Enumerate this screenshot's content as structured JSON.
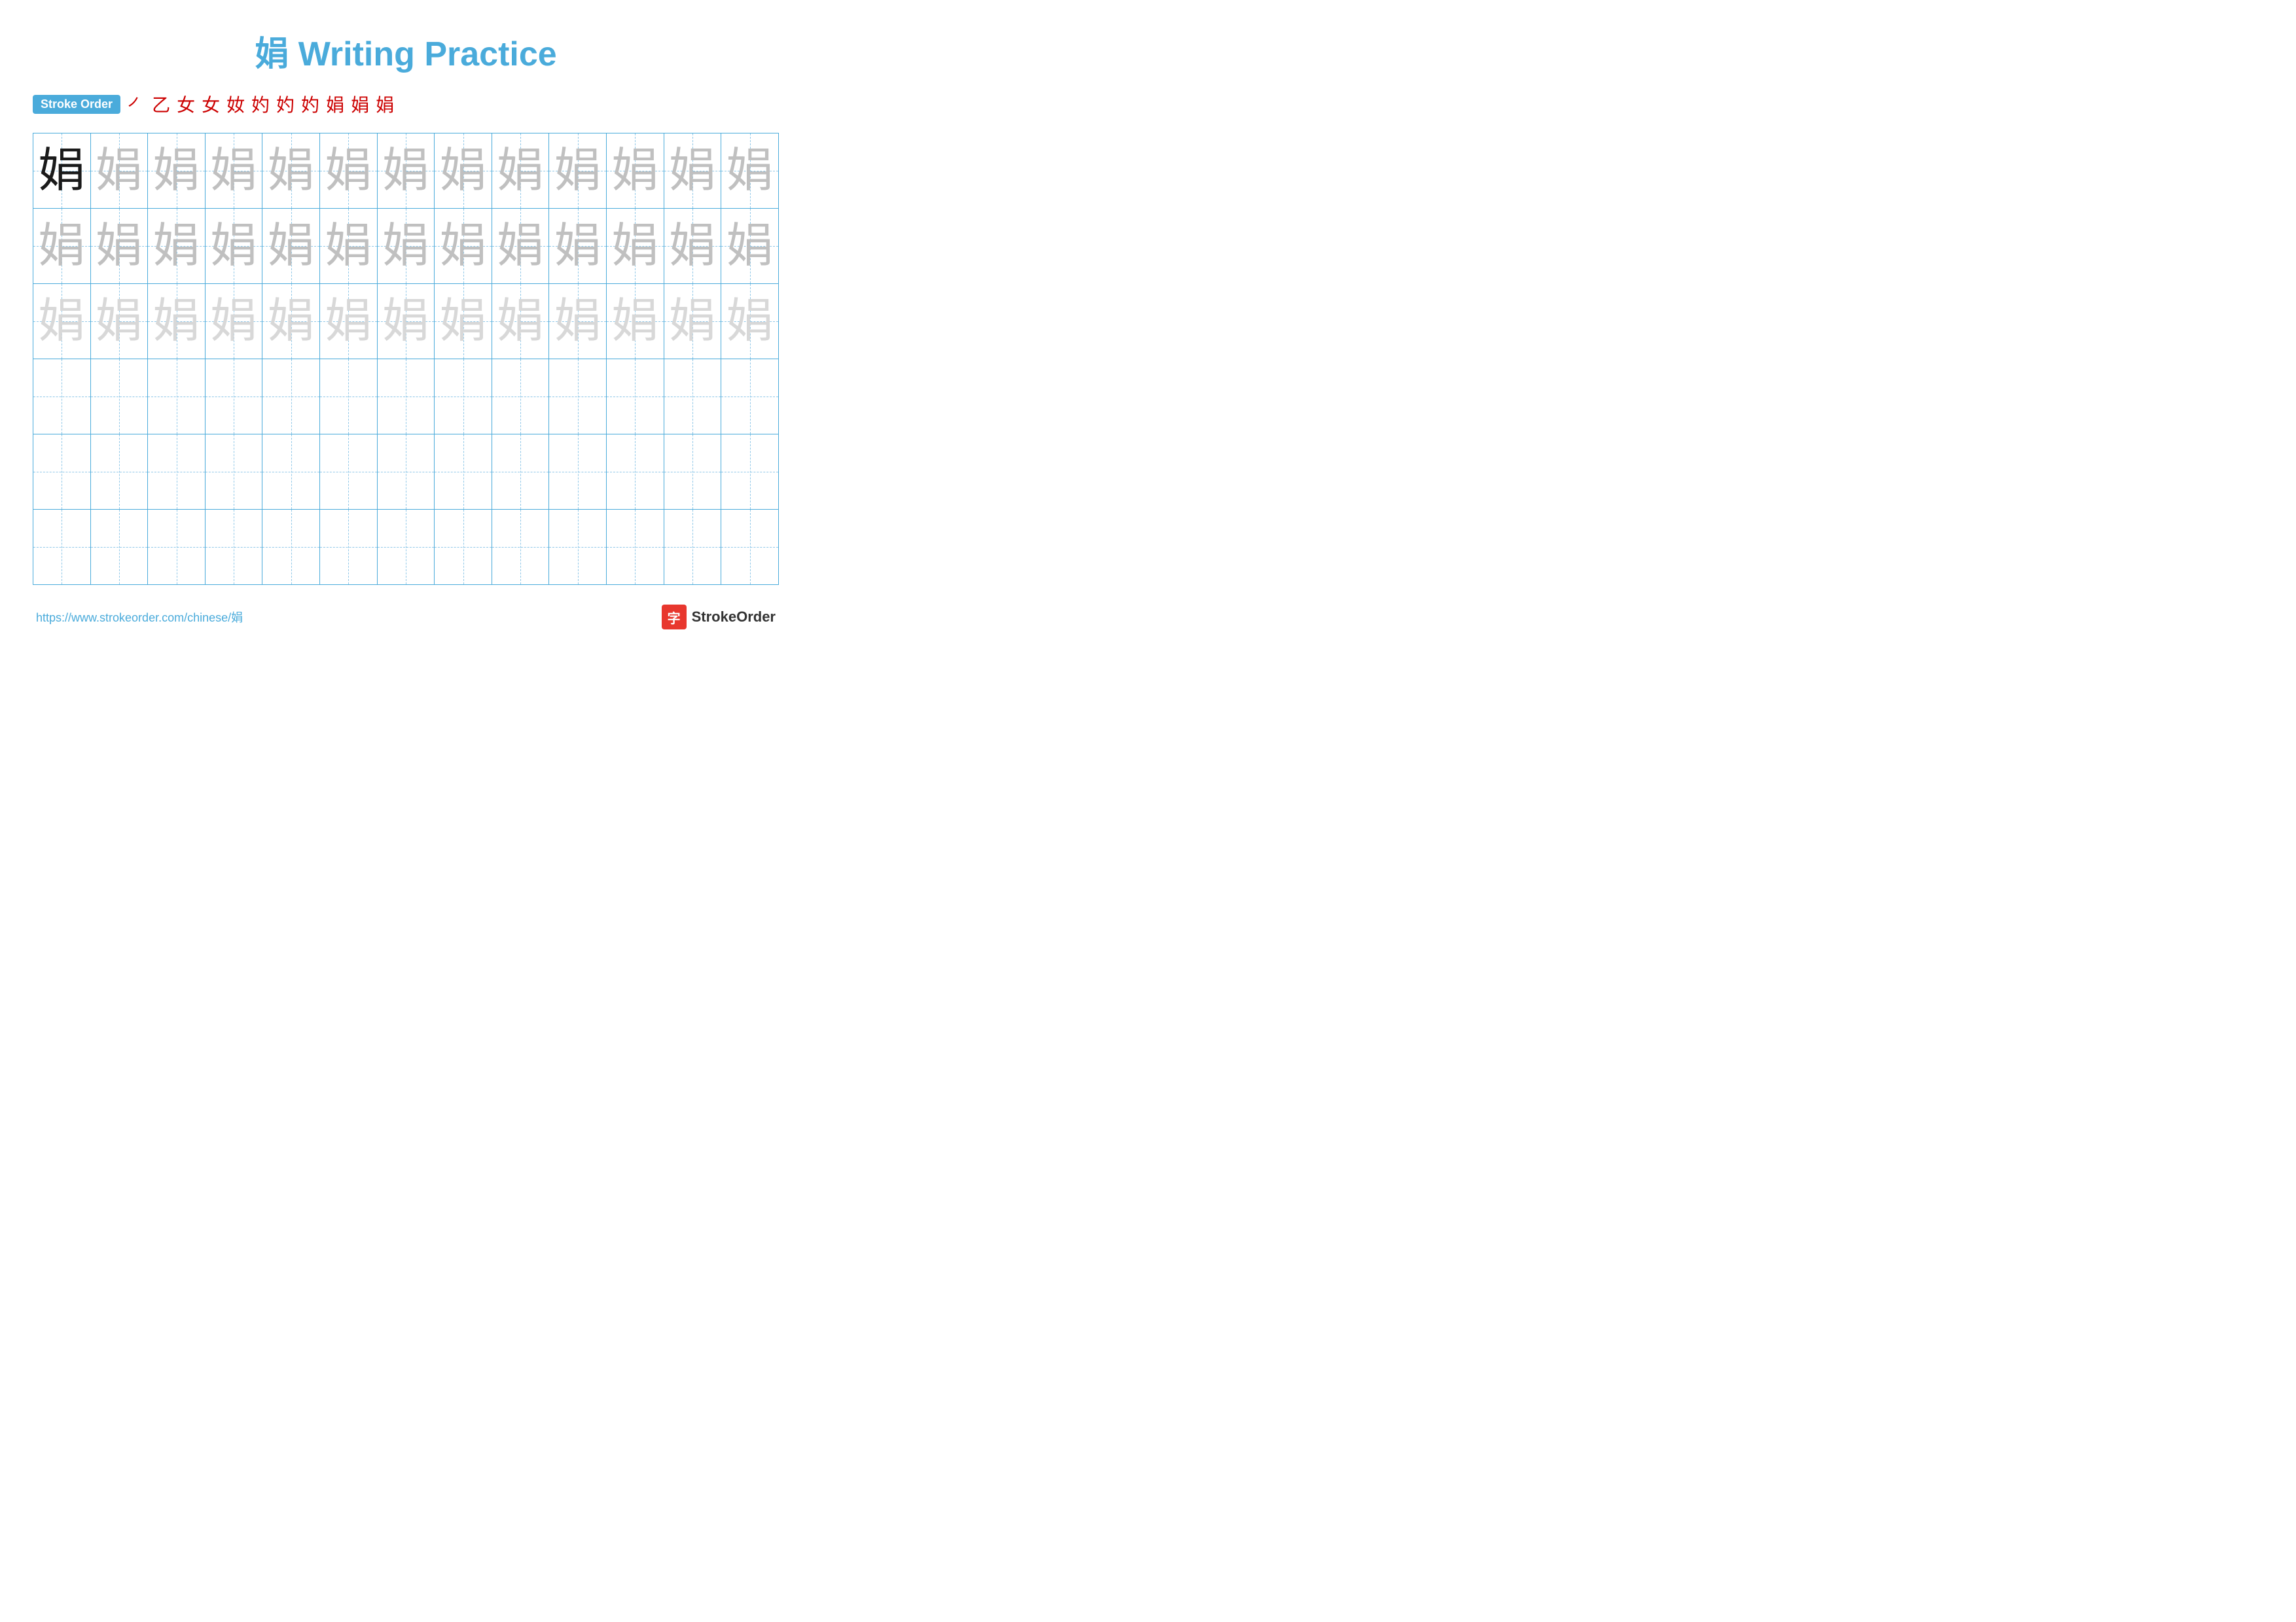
{
  "header": {
    "title": "娟 Writing Practice"
  },
  "stroke_order": {
    "badge_label": "Stroke Order",
    "steps": [
      "㇒",
      "乙",
      "女",
      "女",
      "女⺕",
      "妁",
      "妁",
      "妁",
      "娟",
      "娟",
      "娟"
    ]
  },
  "grid": {
    "rows": 6,
    "cols": 13,
    "character": "娟",
    "row_styles": [
      [
        "dark",
        "medium",
        "medium",
        "medium",
        "medium",
        "medium",
        "medium",
        "medium",
        "medium",
        "medium",
        "medium",
        "medium",
        "medium"
      ],
      [
        "medium",
        "medium",
        "medium",
        "medium",
        "medium",
        "medium",
        "medium",
        "medium",
        "medium",
        "medium",
        "medium",
        "medium",
        "medium"
      ],
      [
        "light",
        "light",
        "light",
        "light",
        "light",
        "light",
        "light",
        "light",
        "light",
        "light",
        "light",
        "light",
        "light"
      ],
      [
        "empty",
        "empty",
        "empty",
        "empty",
        "empty",
        "empty",
        "empty",
        "empty",
        "empty",
        "empty",
        "empty",
        "empty",
        "empty"
      ],
      [
        "empty",
        "empty",
        "empty",
        "empty",
        "empty",
        "empty",
        "empty",
        "empty",
        "empty",
        "empty",
        "empty",
        "empty",
        "empty"
      ],
      [
        "empty",
        "empty",
        "empty",
        "empty",
        "empty",
        "empty",
        "empty",
        "empty",
        "empty",
        "empty",
        "empty",
        "empty",
        "empty"
      ]
    ]
  },
  "footer": {
    "url": "https://www.strokeorder.com/chinese/娟",
    "logo_char": "字",
    "logo_text": "StrokeOrder"
  }
}
